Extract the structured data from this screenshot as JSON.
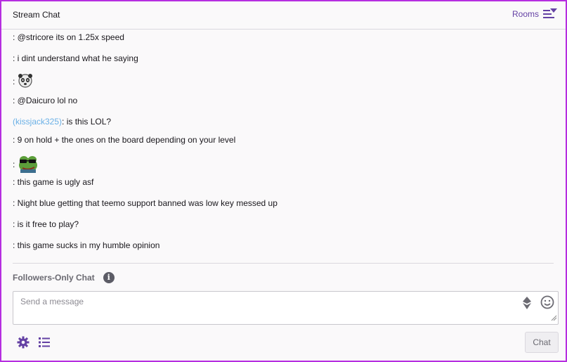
{
  "header": {
    "title": "Stream Chat",
    "rooms_label": "Rooms"
  },
  "messages": [
    {
      "user": "",
      "text": ": @stricore its on 1.25x speed"
    },
    {
      "user": "",
      "text": ": i dint understand what he saying"
    },
    {
      "user": "",
      "text": ":",
      "emote": "panda-face-emote"
    },
    {
      "user": "",
      "text": ": @Daicuro lol no"
    },
    {
      "user": "(kissjack325)",
      "text": ": is this LOL?"
    },
    {
      "user": "",
      "text": ": 9 on hold + the ones on the board depending on your level"
    },
    {
      "user": "",
      "text": ":",
      "emote": "frog-sunglasses-emote"
    },
    {
      "user": "",
      "text": ": this game is ugly asf"
    },
    {
      "user": "",
      "text": ": Night blue getting that teemo support banned was low key messed up"
    },
    {
      "user": "",
      "text": ": is it free to play?"
    },
    {
      "user": "",
      "text": ": this game sucks in my humble opinion"
    }
  ],
  "followers": {
    "label": "Followers-Only Chat",
    "info_glyph": "i"
  },
  "composer": {
    "placeholder": "Send a message"
  },
  "actions": {
    "chat_label": "Chat"
  },
  "colors": {
    "accent": "#6441a4",
    "username": "#6ab0e6",
    "frame": "#b62ee0"
  },
  "icons": [
    "rooms-icon",
    "info-icon",
    "bits-icon",
    "emoji-icon",
    "settings-gear-icon",
    "viewer-list-icon"
  ]
}
